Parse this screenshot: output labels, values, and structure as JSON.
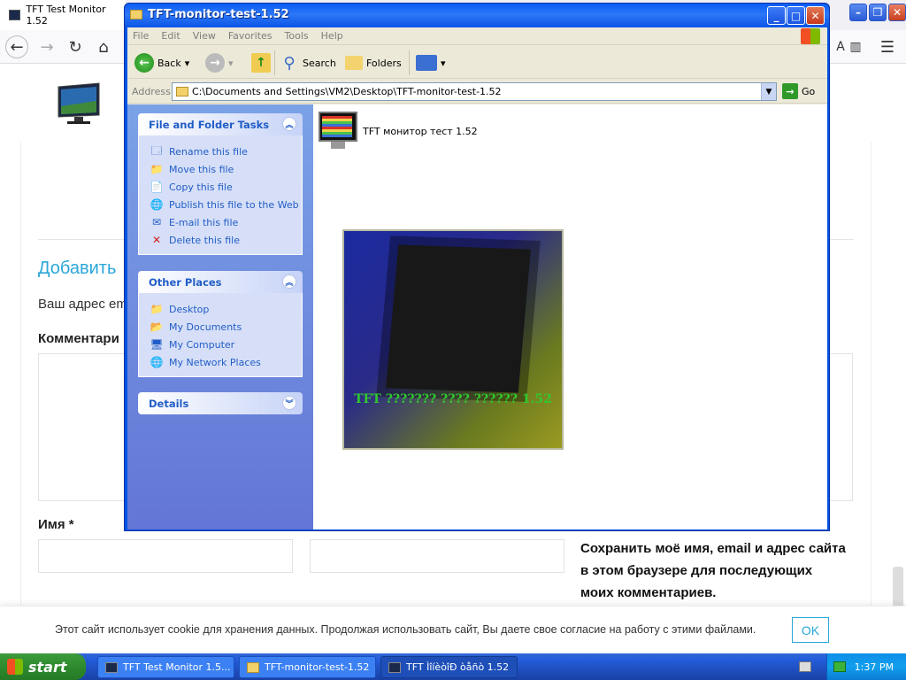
{
  "browser": {
    "tab_title": "TFT Test Monitor 1.52",
    "nav_icons": [
      "back-icon",
      "forward-icon",
      "reload-icon",
      "home-icon",
      "sidebar-icon",
      "menu-icon"
    ]
  },
  "page": {
    "add_heading": "Добавить",
    "email_note": "Ваш адрес em",
    "comment_label": "Комментари",
    "name_label": "Имя *",
    "save_note": "Сохранить моё имя, email и адрес сайта в этом браузере для последующих моих комментариев."
  },
  "cookie": {
    "text": "Этот сайт использует cookie для хранения данных. Продолжая использовать сайт, Вы даете свое согласие на работу с этими файлами.",
    "ok_label": "OK"
  },
  "explorer": {
    "title": "TFT-monitor-test-1.52",
    "menu": [
      "File",
      "Edit",
      "View",
      "Favorites",
      "Tools",
      "Help"
    ],
    "toolbar": {
      "back": "Back",
      "search": "Search",
      "folders": "Folders"
    },
    "address_label": "Address",
    "address_value": "C:\\Documents and Settings\\VM2\\Desktop\\TFT-monitor-test-1.52",
    "go_label": "Go",
    "file_tasks": {
      "title": "File and Folder Tasks",
      "items": [
        "Rename this file",
        "Move this file",
        "Copy this file",
        "Publish this file to the Web",
        "E-mail this file",
        "Delete this file"
      ]
    },
    "other_places": {
      "title": "Other Places",
      "items": [
        "Desktop",
        "My Documents",
        "My Computer",
        "My Network Places"
      ]
    },
    "details": {
      "title": "Details"
    },
    "file_name": "TFT монитор тест 1.52",
    "preview_text": "TFT ??????? ???? ?????? 1.52"
  },
  "taskbar": {
    "start_label": "start",
    "buttons": [
      "TFT Test Monitor 1.5...",
      "TFT-monitor-test-1.52",
      "TFT ÌîíèòîÐ òåñò 1.52"
    ],
    "clock": "1:37 PM"
  }
}
